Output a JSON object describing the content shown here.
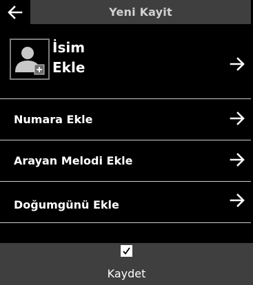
{
  "header": {
    "title": "Yeni Kayit",
    "back_icon": "arrow-left-icon"
  },
  "name_entry": {
    "line1": "İsim",
    "line2": "Ekle",
    "avatar_icon": "add-contact-photo-icon",
    "arrow_icon": "arrow-right-icon"
  },
  "rows": [
    {
      "label": "Numara Ekle",
      "arrow_icon": "arrow-right-icon"
    },
    {
      "label": "Arayan Melodi Ekle",
      "arrow_icon": "arrow-right-icon"
    },
    {
      "label": "Doğumgünü Ekle",
      "arrow_icon": "arrow-right-icon"
    }
  ],
  "footer": {
    "checkbox_icon": "checkmark-icon",
    "save_label": "Kaydet"
  },
  "colors": {
    "background": "#000000",
    "bar": "#3f3f3f",
    "title_text": "#d2d2d2",
    "text": "#ffffff",
    "divider": "#cfcfcf",
    "avatar_border": "#7d7d7d"
  }
}
